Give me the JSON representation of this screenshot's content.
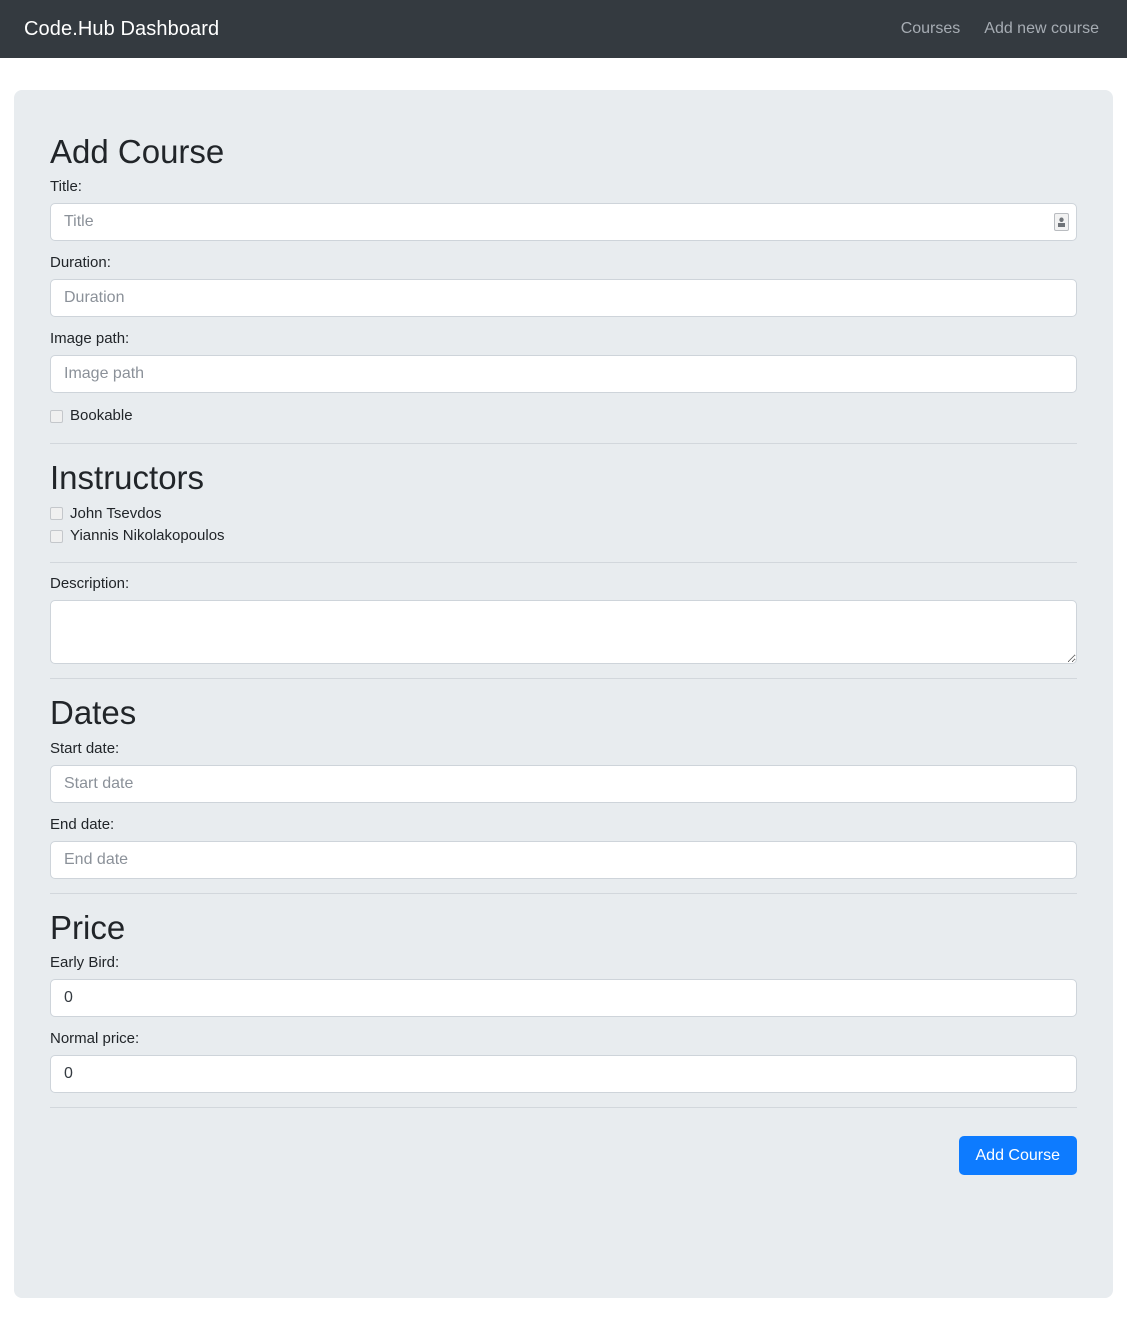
{
  "navbar": {
    "brand": "Code.Hub Dashboard",
    "links": [
      {
        "label": "Courses",
        "name": "nav-link-courses"
      },
      {
        "label": "Add new course",
        "name": "nav-link-add-new-course"
      }
    ]
  },
  "form": {
    "heading": "Add Course",
    "title": {
      "label": "Title:",
      "placeholder": "Title",
      "value": ""
    },
    "duration": {
      "label": "Duration:",
      "placeholder": "Duration",
      "value": ""
    },
    "image_path": {
      "label": "Image path:",
      "placeholder": "Image path",
      "value": ""
    },
    "bookable": {
      "label": "Bookable",
      "checked": false
    },
    "instructors": {
      "heading": "Instructors",
      "items": [
        {
          "label": "John Tsevdos",
          "checked": false
        },
        {
          "label": "Yiannis Nikolakopoulos",
          "checked": false
        }
      ]
    },
    "description": {
      "label": "Description:",
      "placeholder": "",
      "value": ""
    },
    "dates": {
      "heading": "Dates",
      "start": {
        "label": "Start date:",
        "placeholder": "Start date",
        "value": ""
      },
      "end": {
        "label": "End date:",
        "placeholder": "End date",
        "value": ""
      }
    },
    "price": {
      "heading": "Price",
      "early_bird": {
        "label": "Early Bird:",
        "placeholder": "",
        "value": "0"
      },
      "normal": {
        "label": "Normal price:",
        "placeholder": "",
        "value": "0"
      }
    },
    "submit_label": "Add Course"
  },
  "icons": {
    "autofill": "contact-card-icon",
    "resize_grip": "resize-handle-icon"
  },
  "colors": {
    "navbar_bg": "#343a40",
    "card_bg": "#e8ecef",
    "primary": "#0d7bff",
    "page_bg": "#ffffff",
    "border": "#ced4da",
    "text": "#212529",
    "muted": "#8b9199"
  }
}
